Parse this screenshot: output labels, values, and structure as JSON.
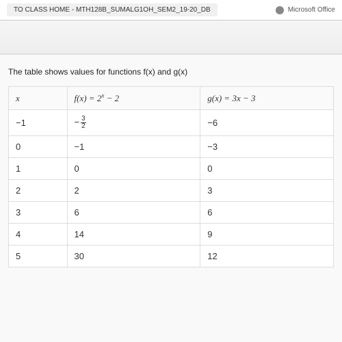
{
  "browser": {
    "tab_title": "TO CLASS HOME - MTH128B_SUMALG1OH_SEM2_19-20_DB",
    "top_right_label": "Microsoft Office"
  },
  "prompt": "The table shows values for functions f(x) and g(x)",
  "table": {
    "headers": {
      "x": "x",
      "f_prefix": "f(x) = 2",
      "f_exp": "x",
      "f_suffix": " − 2",
      "g": "g(x) = 3x − 3"
    },
    "rows": [
      {
        "x": "−1",
        "f_is_frac": true,
        "f_neg": "−",
        "f_num": "3",
        "f_den": "2",
        "g": "−6"
      },
      {
        "x": "0",
        "f_is_frac": false,
        "f": "−1",
        "g": "−3"
      },
      {
        "x": "1",
        "f_is_frac": false,
        "f": "0",
        "g": "0"
      },
      {
        "x": "2",
        "f_is_frac": false,
        "f": "2",
        "g": "3"
      },
      {
        "x": "3",
        "f_is_frac": false,
        "f": "6",
        "g": "6"
      },
      {
        "x": "4",
        "f_is_frac": false,
        "f": "14",
        "g": "9"
      },
      {
        "x": "5",
        "f_is_frac": false,
        "f": "30",
        "g": "12"
      }
    ]
  },
  "chart_data": {
    "type": "table",
    "title": "Values for f(x) = 2^x − 2 and g(x) = 3x − 3",
    "columns": [
      "x",
      "f(x)",
      "g(x)"
    ],
    "x": [
      -1,
      0,
      1,
      2,
      3,
      4,
      5
    ],
    "series": [
      {
        "name": "f(x) = 2^x − 2",
        "values": [
          -1.5,
          -1,
          0,
          2,
          6,
          14,
          30
        ]
      },
      {
        "name": "g(x) = 3x − 3",
        "values": [
          -6,
          -3,
          0,
          3,
          6,
          9,
          12
        ]
      }
    ]
  }
}
